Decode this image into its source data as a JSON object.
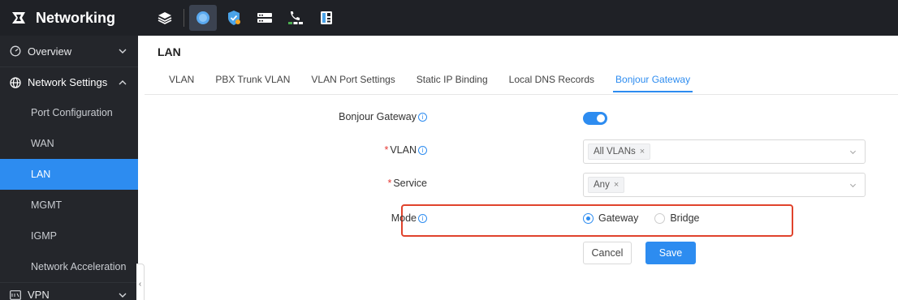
{
  "brand": {
    "title": "Networking"
  },
  "topbar": {
    "icons": [
      "layers-icon",
      "globe-icon",
      "shield-check-icon",
      "switch-icon",
      "phone-network-icon",
      "desk-phone-icon"
    ]
  },
  "sidebar": {
    "overview": "Overview",
    "network_settings": "Network Settings",
    "items": [
      "Port Configuration",
      "WAN",
      "LAN",
      "MGMT",
      "IGMP",
      "Network Acceleration"
    ],
    "vpn": "VPN"
  },
  "main": {
    "page_title": "LAN",
    "tabs": [
      "VLAN",
      "PBX Trunk VLAN",
      "VLAN Port Settings",
      "Static IP Binding",
      "Local DNS Records",
      "Bonjour Gateway"
    ],
    "active_tab": "Bonjour Gateway"
  },
  "form": {
    "bonjour_gateway_label": "Bonjour Gateway",
    "bonjour_gateway_enabled": true,
    "required_mark": "*",
    "vlan_label": "VLAN",
    "vlan_tag": "All VLANs",
    "service_label": "Service",
    "service_tag": "Any",
    "tag_remove": "×",
    "mode_label": "Mode",
    "mode_options": [
      "Gateway",
      "Bridge"
    ],
    "mode_selected": "Gateway",
    "cancel_label": "Cancel",
    "save_label": "Save"
  },
  "colors": {
    "accent": "#2d8cf0",
    "sidebar_bg": "#24262b",
    "topbar_bg": "#1f2126",
    "highlight": "#e0432c"
  }
}
